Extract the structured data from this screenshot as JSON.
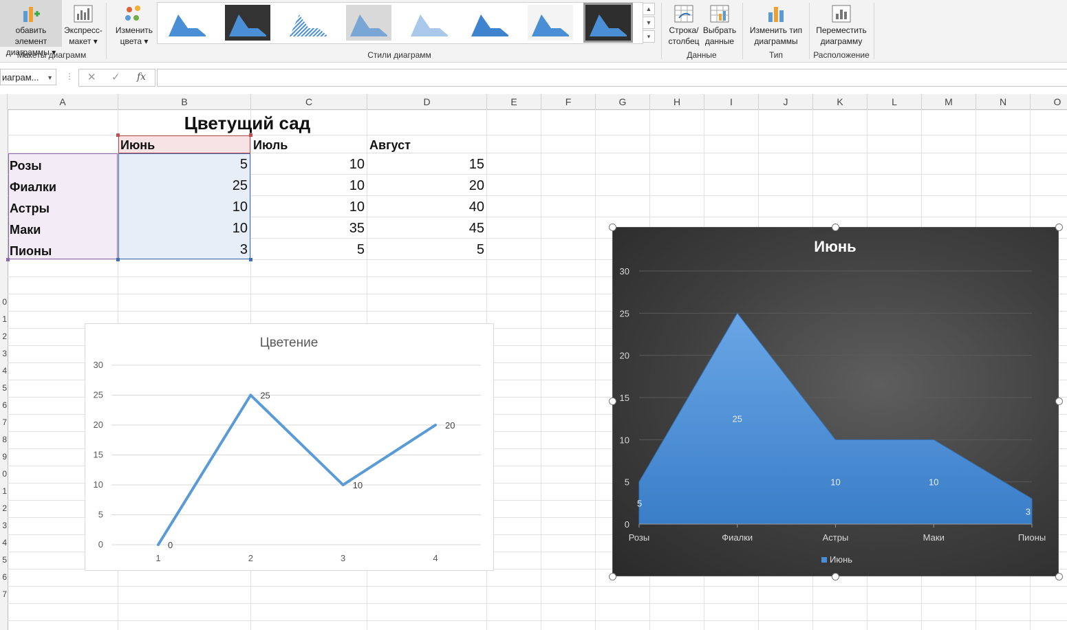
{
  "ribbon": {
    "add_element": {
      "line1": "обавить элемент",
      "line2": "диаграммы"
    },
    "quick_layout": {
      "line1": "Экспресс-",
      "line2": "макет"
    },
    "change_colors": {
      "line1": "Изменить",
      "line2": "цвета"
    },
    "switch_row_col": {
      "line1": "Строка/",
      "line2": "столбец"
    },
    "select_data": {
      "line1": "Выбрать",
      "line2": "данные"
    },
    "change_type": {
      "line1": "Изменить тип",
      "line2": "диаграммы"
    },
    "move_chart": {
      "line1": "Переместить",
      "line2": "диаграмму"
    },
    "groups": {
      "layouts": "Макеты диаграмм",
      "styles": "Стили диаграмм",
      "data": "Данные",
      "type": "Тип",
      "location": "Расположение"
    }
  },
  "formula_bar": {
    "name_box": "иаграм...",
    "fx": "fx",
    "cancel": "✕",
    "enter": "✓",
    "formula": ""
  },
  "columns": [
    "A",
    "B",
    "C",
    "D",
    "E",
    "F",
    "G",
    "H",
    "I",
    "J",
    "K",
    "L",
    "M",
    "N",
    "O"
  ],
  "row_numbers": [
    "0",
    "1",
    "2",
    "3",
    "4",
    "5",
    "6",
    "7",
    "8",
    "9",
    "0",
    "1",
    "2",
    "3",
    "4",
    "5",
    "6",
    "7"
  ],
  "sheet": {
    "title": "Цветущий сад",
    "headers": [
      "Июнь",
      "Июль",
      "Август"
    ],
    "rows": [
      {
        "label": "Розы",
        "values": [
          "5",
          "10",
          "15"
        ]
      },
      {
        "label": "Фиалки",
        "values": [
          "25",
          "10",
          "20"
        ]
      },
      {
        "label": "Астры",
        "values": [
          "10",
          "10",
          "40"
        ]
      },
      {
        "label": "Маки",
        "values": [
          "10",
          "35",
          "45"
        ]
      },
      {
        "label": "Пионы",
        "values": [
          "3",
          "5",
          "5"
        ]
      }
    ]
  },
  "chart_data": [
    {
      "type": "line",
      "title": "Цветение",
      "x": [
        1,
        2,
        3,
        4
      ],
      "xticks": [
        "1",
        "2",
        "3",
        "4"
      ],
      "series": [
        {
          "values": [
            0,
            25,
            10,
            20
          ],
          "labels": [
            "0",
            "25",
            "10",
            "20"
          ]
        }
      ],
      "yticks": [
        "0",
        "5",
        "10",
        "15",
        "20",
        "25",
        "30"
      ],
      "ylim": [
        0,
        30
      ],
      "color": "#5b9bd5",
      "grid": true
    },
    {
      "type": "area",
      "title": "Июнь",
      "categories": [
        "Розы",
        "Фиалки",
        "Астры",
        "Маки",
        "Пионы"
      ],
      "series": [
        {
          "name": "Июнь",
          "values": [
            5,
            25,
            10,
            10,
            3
          ],
          "labels": [
            "5",
            "25",
            "10",
            "10",
            "3"
          ]
        }
      ],
      "yticks": [
        "0",
        "5",
        "10",
        "15",
        "20",
        "25",
        "30"
      ],
      "ylim": [
        0,
        30
      ],
      "legend": "bottom",
      "color": "#4a8fd6",
      "background": "#3a3a3a",
      "grid": true
    }
  ]
}
